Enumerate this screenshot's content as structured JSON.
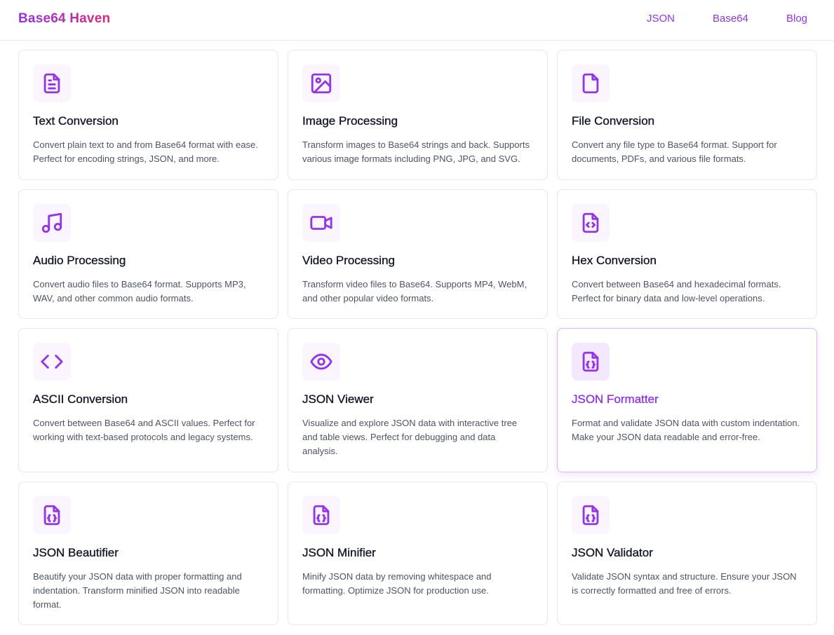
{
  "header": {
    "brand": "Base64 Haven",
    "nav": [
      "JSON",
      "Base64",
      "Blog"
    ]
  },
  "accent_color": "#9333ea",
  "cards": [
    {
      "title": "Text Conversion",
      "desc": "Convert plain text to and from Base64 format with ease. Perfect for encoding strings, JSON, and more.",
      "icon": "document-text-icon"
    },
    {
      "title": "Image Processing",
      "desc": "Transform images to Base64 strings and back. Supports various image formats including PNG, JPG, and SVG.",
      "icon": "image-icon"
    },
    {
      "title": "File Conversion",
      "desc": "Convert any file type to Base64 format. Support for documents, PDFs, and various file formats.",
      "icon": "file-icon"
    },
    {
      "title": "Audio Processing",
      "desc": "Convert audio files to Base64 format. Supports MP3, WAV, and other common audio formats.",
      "icon": "music-note-icon"
    },
    {
      "title": "Video Processing",
      "desc": "Transform video files to Base64. Supports MP4, WebM, and other popular video formats.",
      "icon": "video-camera-icon"
    },
    {
      "title": "Hex Conversion",
      "desc": "Convert between Base64 and hexadecimal formats. Perfect for binary data and low-level operations.",
      "icon": "file-code-icon"
    },
    {
      "title": "ASCII Conversion",
      "desc": "Convert between Base64 and ASCII values. Perfect for working with text-based protocols and legacy systems.",
      "icon": "code-brackets-icon"
    },
    {
      "title": "JSON Viewer",
      "desc": "Visualize and explore JSON data with interactive tree and table views. Perfect for debugging and data analysis.",
      "icon": "eye-icon"
    },
    {
      "title": "JSON Formatter",
      "desc": "Format and validate JSON data with custom indentation. Make your JSON data readable and error-free.",
      "icon": "file-json-icon"
    },
    {
      "title": "JSON Beautifier",
      "desc": "Beautify your JSON data with proper formatting and indentation. Transform minified JSON into readable format.",
      "icon": "file-json-icon"
    },
    {
      "title": "JSON Minifier",
      "desc": "Minify JSON data by removing whitespace and formatting. Optimize JSON for production use.",
      "icon": "file-json-icon"
    },
    {
      "title": "JSON Validator",
      "desc": "Validate JSON syntax and structure. Ensure your JSON is correctly formatted and free of errors.",
      "icon": "file-json-icon"
    }
  ]
}
